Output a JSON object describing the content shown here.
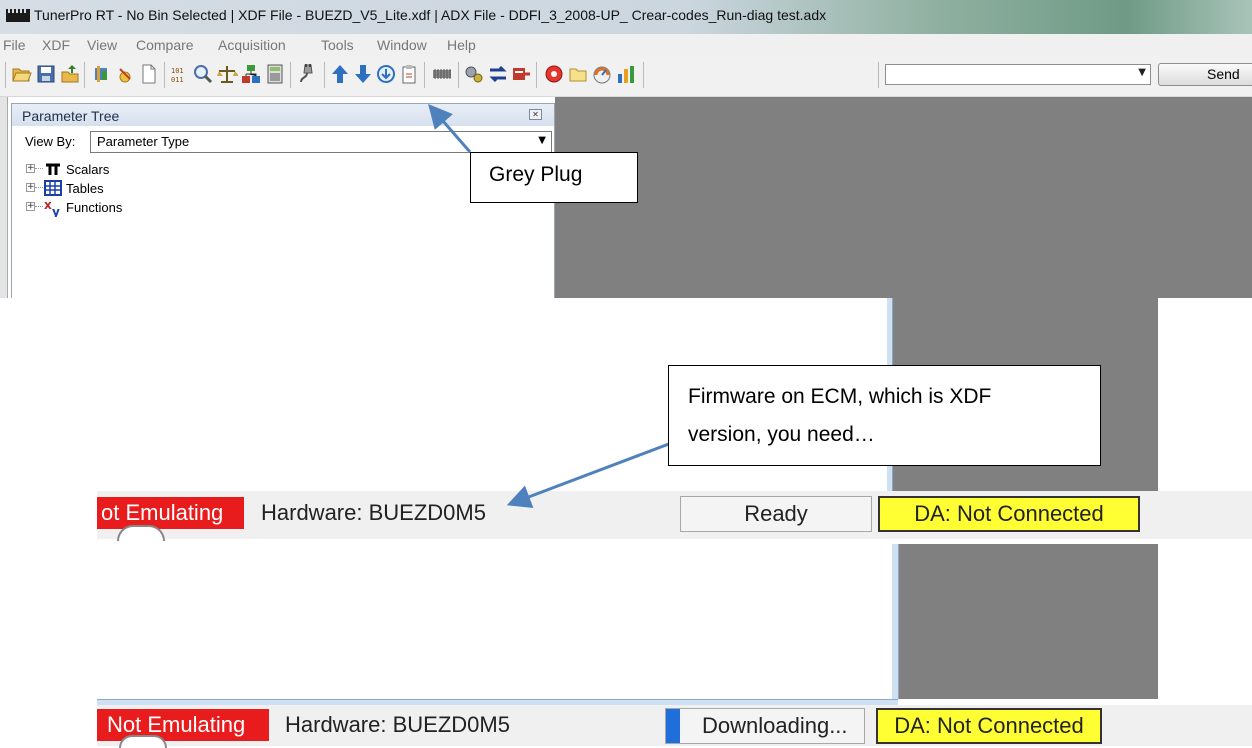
{
  "window": {
    "title": "TunerPro RT - No Bin Selected | XDF File - BUEZD_V5_Lite.xdf | ADX File - DDFI_3_2008-UP_ Crear-codes_Run-diag test.adx"
  },
  "menu": [
    "File",
    "XDF",
    "View",
    "Compare",
    "Acquisition",
    "Tools",
    "Window",
    "Help"
  ],
  "toolbar": {
    "icons": [
      "open-folder-icon",
      "save-icon",
      "upload-icon",
      "chip-icon",
      "checksum-icon",
      "new-document-icon",
      "binary-icon",
      "search-icon",
      "compare-scales-icon",
      "network-icon",
      "calculator-icon",
      "grey-plug-icon",
      "arrow-up-icon",
      "arrow-down-icon",
      "download-icon",
      "clipboard-icon",
      "memory-chip-icon",
      "gears-icon",
      "swap-arrows-icon",
      "emulator-icon",
      "record-icon",
      "folder-icon",
      "gauge-icon",
      "bar-chart-icon"
    ],
    "command_value": "",
    "send_label": "Send"
  },
  "parameter_tree": {
    "title": "Parameter Tree",
    "view_by_label": "View By:",
    "view_by_value": "Parameter Type",
    "items": [
      {
        "label": "Scalars",
        "icon": "pi-icon"
      },
      {
        "label": "Tables",
        "icon": "table-icon"
      },
      {
        "label": "Functions",
        "icon": "xy-function-icon"
      }
    ]
  },
  "callouts": {
    "grey_plug": "Grey Plug",
    "firmware_line1": "Firmware on ECM, which is XDF",
    "firmware_line2": "version, you need…"
  },
  "status_top": {
    "emulation": "ot Emulating",
    "hardware": "Hardware: BUEZD0M5",
    "status": "Ready",
    "da": "DA: Not Connected"
  },
  "status_bottom": {
    "emulation": "Not Emulating",
    "hardware": "Hardware: BUEZD0M5",
    "status": "Downloading...",
    "progress": 0.07,
    "da": "DA: Not Connected"
  },
  "colors": {
    "workspace": "#808080",
    "emulation_bg": "#e81c1c",
    "da_bg": "#ffff33",
    "arrow": "#4f81bd"
  }
}
